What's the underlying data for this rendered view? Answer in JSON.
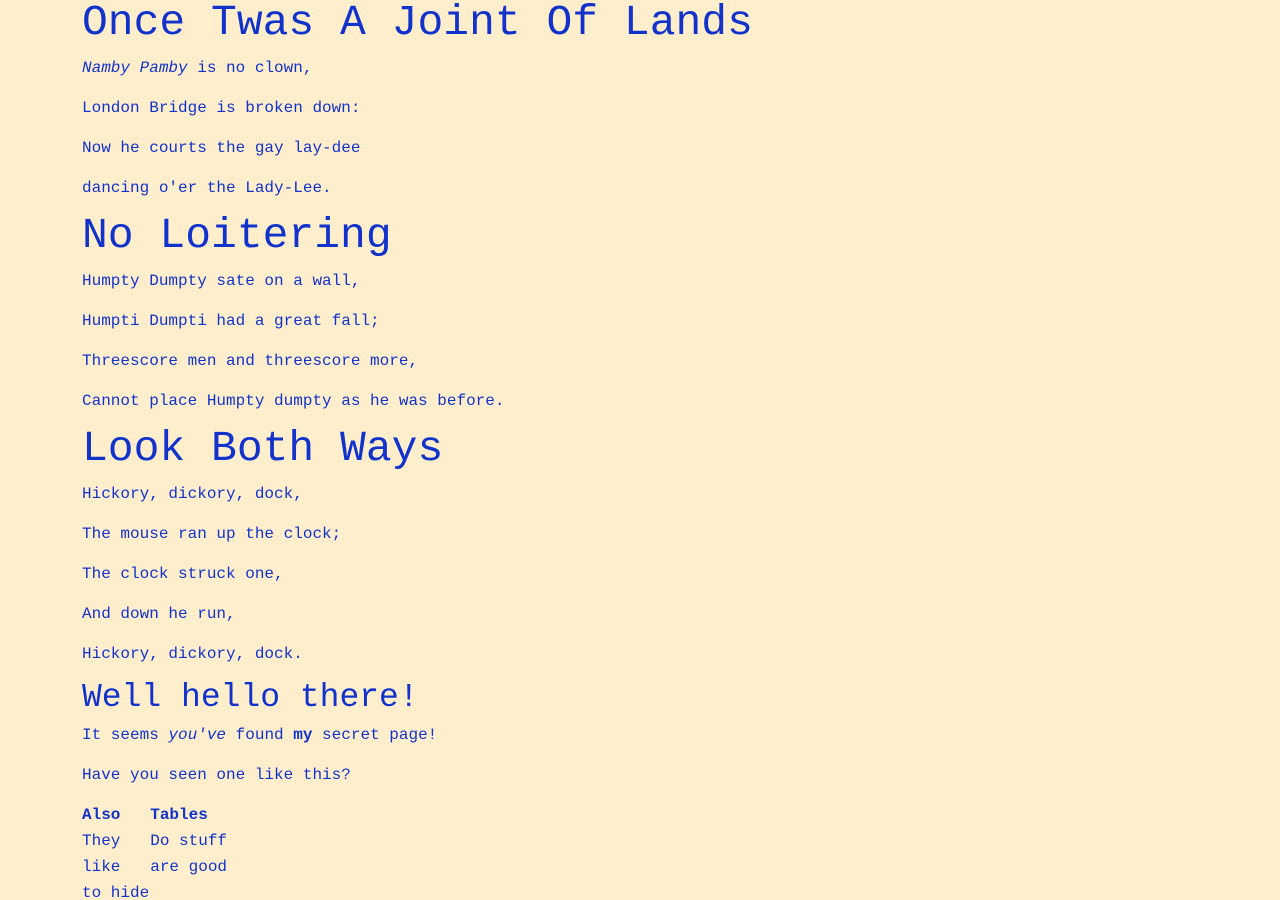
{
  "sections": [
    {
      "title": "Once Twas A Joint Of Lands",
      "line1_name": "Namby Pamby",
      "line1_rest": " is no clown,",
      "line2": "London Bridge is broken down:",
      "line3": "Now he courts the gay lay-dee",
      "line4": "dancing o'er the Lady-Lee."
    },
    {
      "title": "No Loitering",
      "line1": "Humpty Dumpty sate on a wall,",
      "line2": "Humpti Dumpti had a great fall;",
      "line3": "Threescore men and threescore more,",
      "line4": "Cannot place Humpty dumpty as he was before."
    },
    {
      "title": "Look Both Ways",
      "line1": "Hickory, dickory, dock,",
      "line2": "The mouse ran up the clock;",
      "line3": "The clock struck one,",
      "line4": "And down he run,",
      "line5": "Hickory, dickory, dock."
    }
  ],
  "secret": {
    "title": "Well hello there!",
    "p1_a": "It seems ",
    "p1_em": "you've",
    "p1_b": " found ",
    "p1_strong": "my",
    "p1_c": " secret page!",
    "p2": "Have you seen one like this?"
  },
  "table": {
    "headers": [
      "Also",
      "Tables"
    ],
    "rows": [
      [
        "They",
        "Do stuff"
      ],
      [
        "like",
        "are good"
      ],
      [
        "to hide",
        ""
      ]
    ]
  }
}
